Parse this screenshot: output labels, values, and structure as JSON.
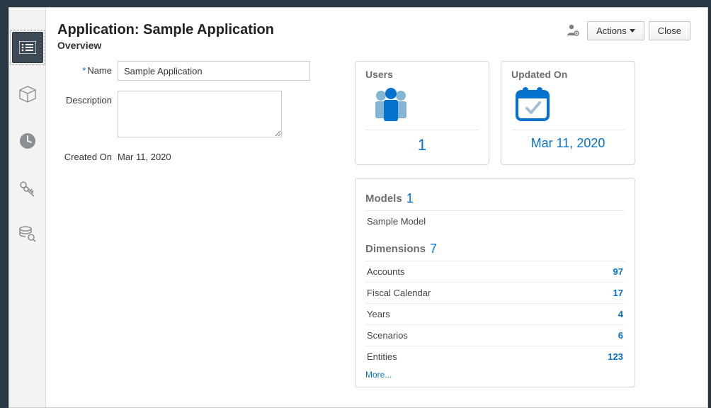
{
  "header": {
    "title": "Application: Sample Application",
    "subtitle": "Overview",
    "actions_label": "Actions",
    "close_label": "Close"
  },
  "form": {
    "name_label": "Name",
    "name_value": "Sample Application",
    "description_label": "Description",
    "description_value": "",
    "created_on_label": "Created On",
    "created_on_value": "Mar 11, 2020"
  },
  "cards": {
    "users": {
      "title": "Users",
      "value": "1"
    },
    "updated_on": {
      "title": "Updated On",
      "value": "Mar 11, 2020"
    }
  },
  "models": {
    "title": "Models",
    "count": "1",
    "name": "Sample Model"
  },
  "dimensions": {
    "title": "Dimensions",
    "count": "7",
    "items": [
      {
        "name": "Accounts",
        "value": "97"
      },
      {
        "name": "Fiscal Calendar",
        "value": "17"
      },
      {
        "name": "Years",
        "value": "4"
      },
      {
        "name": "Scenarios",
        "value": "6"
      },
      {
        "name": "Entities",
        "value": "123"
      }
    ],
    "more_label": "More..."
  }
}
